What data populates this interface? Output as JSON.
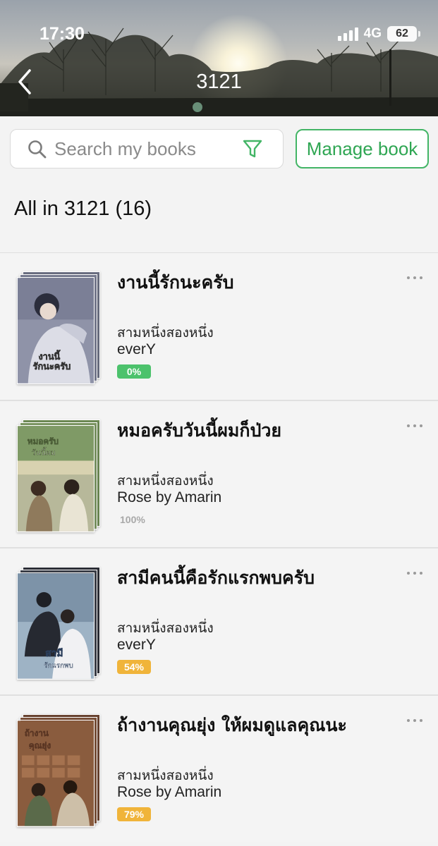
{
  "status_bar": {
    "time": "17:30",
    "network": "4G",
    "battery": "62"
  },
  "nav": {
    "title": "3121",
    "back_icon": "chevron-left-icon"
  },
  "search": {
    "placeholder": "Search my books",
    "value": "",
    "icon": "search-icon",
    "filter_icon": "filter-icon"
  },
  "manage_button": {
    "label": "Manage book"
  },
  "section": {
    "title": "All in 3121 (16)"
  },
  "colors": {
    "accent": "#43b566",
    "progress_green": "#4cc26c",
    "progress_orange": "#f0b43a",
    "progress_done": "#a8a8a8"
  },
  "books": [
    {
      "title": "งานนี้รักนะครับ",
      "author": "สามหนึ่งสองหนึ่ง",
      "publisher": "everY",
      "progress": "0%",
      "progress_value": 0,
      "cover": "book-cover-1"
    },
    {
      "title": "หมอครับวันนี้ผมก็ป่วย",
      "author": "สามหนึ่งสองหนึ่ง",
      "publisher": "Rose by Amarin",
      "progress": "100%",
      "progress_value": 100,
      "cover": "book-cover-2"
    },
    {
      "title": "สามีคนนี้คือรักแรกพบครับ",
      "author": "สามหนึ่งสองหนึ่ง",
      "publisher": "everY",
      "progress": "54%",
      "progress_value": 54,
      "cover": "book-cover-3"
    },
    {
      "title": "ถ้างานคุณยุ่ง ให้ผมดูแลคุณนะ",
      "author": "สามหนึ่งสองหนึ่ง",
      "publisher": "Rose by Amarin",
      "progress": "79%",
      "progress_value": 79,
      "cover": "book-cover-4"
    }
  ]
}
